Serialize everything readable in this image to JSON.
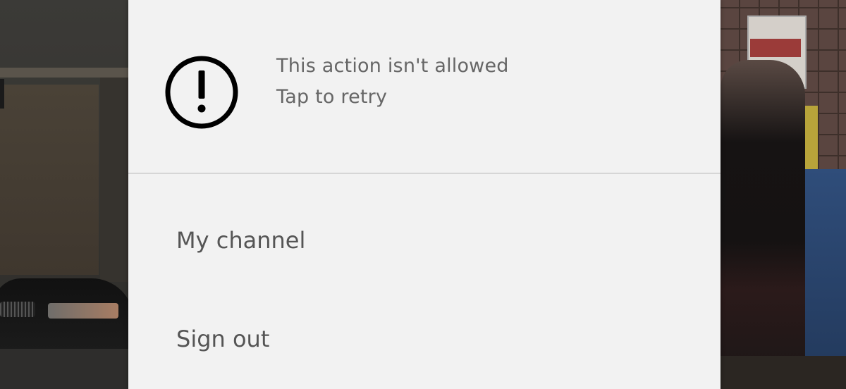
{
  "error_banner": {
    "icon": "exclamation-circle-icon",
    "title": "This action isn't allowed",
    "subtitle": "Tap to retry"
  },
  "menu": {
    "items": [
      {
        "label": "My channel"
      },
      {
        "label": "Sign out"
      }
    ]
  },
  "colors": {
    "sheet_background": "#f2f2f2",
    "text": "#555555",
    "secondary_text": "#666666",
    "divider": "#d6d6d6"
  }
}
